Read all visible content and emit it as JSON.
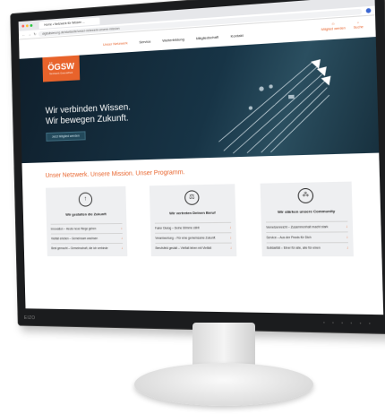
{
  "browser": {
    "tab_title": "Home • Netzwerk für Wissen ...",
    "url": "digitalisierung.de/startseite/unser-netzwerk-unsere-mission",
    "nav_back": "←",
    "nav_forward": "→",
    "nav_reload": "↻"
  },
  "site": {
    "menu": [
      {
        "label": "Unser Netzwerk",
        "active": true
      },
      {
        "label": "Service"
      },
      {
        "label": "Weiterbildung"
      },
      {
        "label": "Mitgliedschaft"
      },
      {
        "label": "Kontakt"
      }
    ],
    "top_icons": [
      {
        "icon": "user-icon",
        "label": "Mitglied werden"
      },
      {
        "icon": "search-icon",
        "label": "Suche"
      }
    ],
    "logo": {
      "text": "ÖGSW",
      "sub": "Netzwerk Gesundheit"
    },
    "hero": {
      "headline_1": "Wir verbinden Wissen.",
      "headline_2": "Wir bewegen Zukunft.",
      "button": "Jetzt Mitglied werden"
    },
    "section_title": "Unser Netzwerk. Unsere Mission. Unser Programm.",
    "cards": [
      {
        "icon": "arrow-up-icon",
        "title": "Wir gestalten die Zukunft",
        "rows": [
          "Innovation – Heute neue Wege gehen",
          "Vielfalt erleben – Gemeinsam wachsen",
          "Best gemacht – Gemeinschaft, die ich verbinde"
        ]
      },
      {
        "icon": "scales-icon",
        "title": "Wir vertreten Deinen Beruf",
        "rows": [
          "Fairer Dialog – Deine Stimme zählt",
          "Verantwortung – Für eine gemeinsame Zukunft",
          "Berufsfeld gestalt – Vielfalt leben mit Vielfalt"
        ]
      },
      {
        "icon": "network-icon",
        "title": "Wir stärken unsere Community",
        "rows": [
          "Vernetzenreicht – Zusammenhalt macht stark",
          "Service – Aus der Praxis für Dich",
          "Solidarität – Einer für alle, alle für einen"
        ]
      }
    ]
  },
  "chin": {
    "brand": "EIZO",
    "buttons": "• • • • • •"
  }
}
